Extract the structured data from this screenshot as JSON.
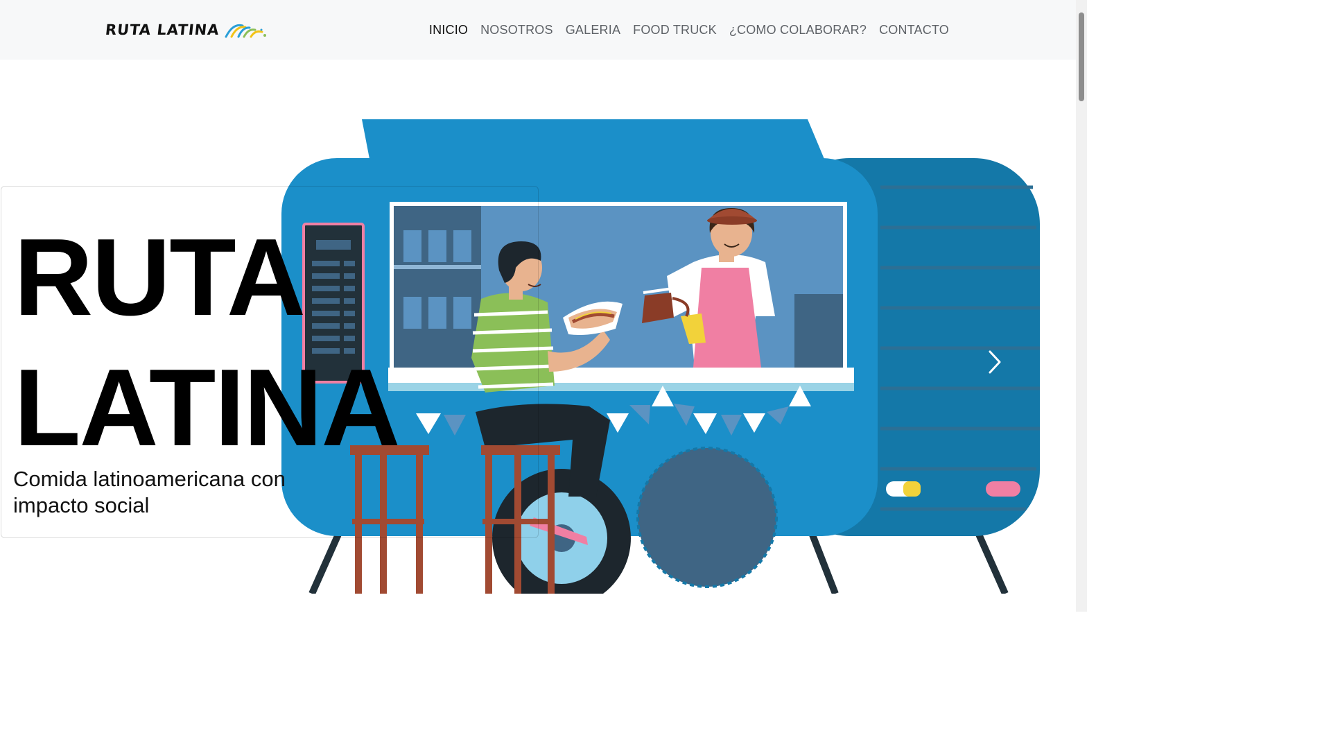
{
  "navbar": {
    "brand": "RUTA LATINA",
    "links": [
      "INICIO",
      "NOSOTROS",
      "GALERIA",
      "FOOD TRUCK",
      "¿COMO COLABORAR?",
      "CONTACTO"
    ],
    "active_index": 0
  },
  "hero": {
    "title_line1": "RUTA",
    "title_line2": "LATINA",
    "subtitle": "Comida latinoamericana con impacto social"
  },
  "icons": {
    "carousel_next": "chevron-right-icon",
    "brand_mark": "rainbow-arc-icon"
  },
  "colors": {
    "truck_blue": "#1b8fc9",
    "truck_dark": "#1478a8",
    "shirt_green": "#8bbf58",
    "apron_pink": "#f07fa3",
    "nav_bg": "#f7f8f9"
  }
}
